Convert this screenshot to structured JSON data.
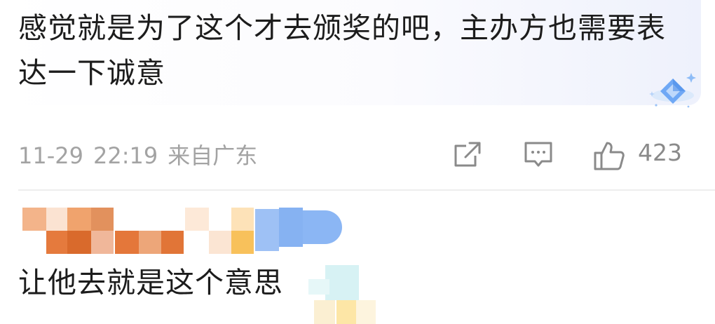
{
  "comment": {
    "text": "感觉就是为了这个才去颁奖的吧，主办方也需要表达一下诚意",
    "badge_icon": "diamond-badge-icon",
    "date": "11-29",
    "time": "22:19",
    "location": "来自广东",
    "actions": {
      "share_icon": "share-icon",
      "reply_icon": "comment-icon",
      "like_icon": "thumbs-up-icon",
      "like_count": "423"
    }
  },
  "reply": {
    "text": "让他去就是这个意思"
  },
  "colors": {
    "meta_text": "#a3a3a3",
    "icon": "#8a8a8a",
    "badge": "#6fa8f5"
  }
}
